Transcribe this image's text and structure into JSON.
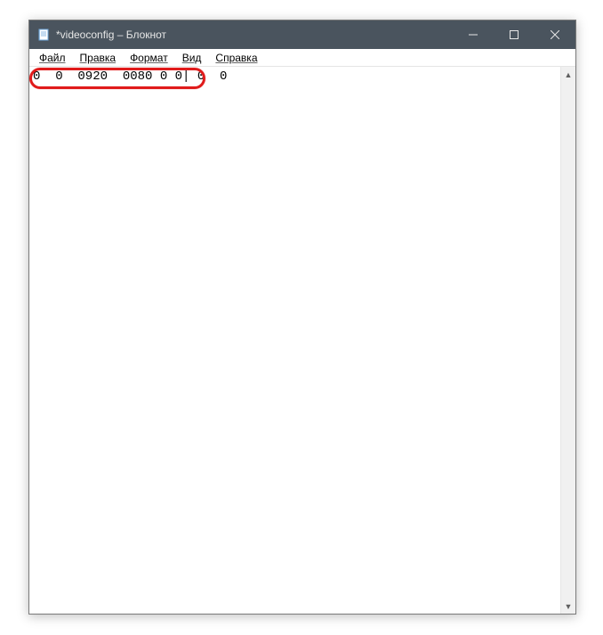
{
  "window": {
    "title": "*videoconfig – Блокнот"
  },
  "menu": {
    "file": "Файл",
    "edit": "Правка",
    "format": "Формат",
    "view": "Вид",
    "help": "Справка"
  },
  "editor": {
    "content": "0  0  0920  0080 0 0| 0  0"
  }
}
